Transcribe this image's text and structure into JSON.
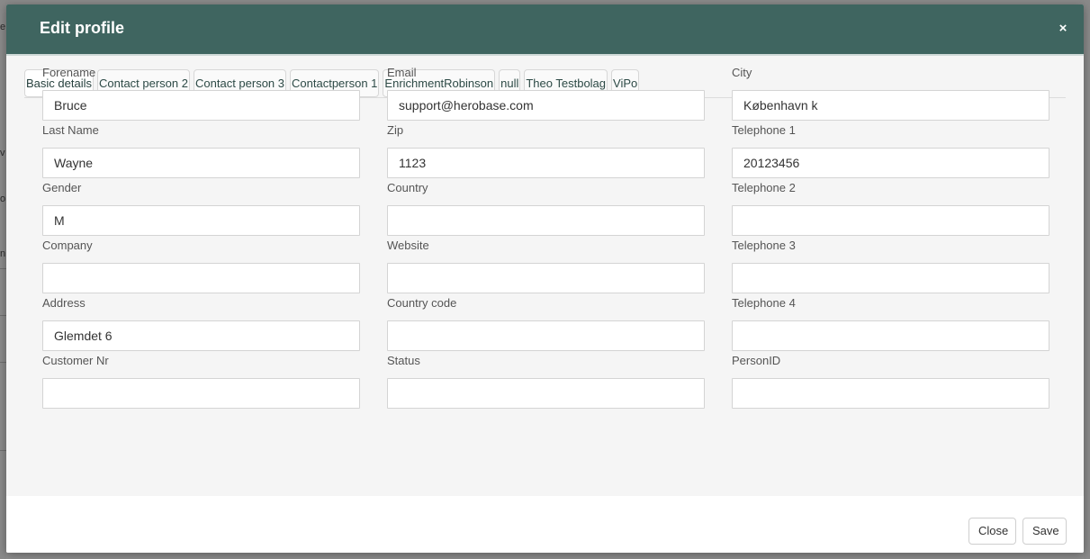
{
  "modal": {
    "title": "Edit profile",
    "close_glyph": "×"
  },
  "tabs": [
    {
      "label": "Basic details",
      "active": true
    },
    {
      "label": "Contact person 2",
      "active": false
    },
    {
      "label": "Contact person 3",
      "active": false
    },
    {
      "label": "Contactperson 1",
      "active": false
    },
    {
      "label": "EnrichmentRobinson",
      "active": false
    },
    {
      "label": "null",
      "active": false
    },
    {
      "label": "Theo Testbolag",
      "active": false
    },
    {
      "label": "ViPo",
      "active": false
    }
  ],
  "fields": {
    "forename": {
      "label": "Forename",
      "value": "Bruce"
    },
    "email": {
      "label": "Email",
      "value": "support@herobase.com"
    },
    "city": {
      "label": "City",
      "value": "København k"
    },
    "last_name": {
      "label": "Last Name",
      "value": "Wayne"
    },
    "zip": {
      "label": "Zip",
      "value": "1123"
    },
    "telephone1": {
      "label": "Telephone 1",
      "value": "20123456"
    },
    "gender": {
      "label": "Gender",
      "value": "M"
    },
    "country": {
      "label": "Country",
      "value": ""
    },
    "telephone2": {
      "label": "Telephone 2",
      "value": ""
    },
    "company": {
      "label": "Company",
      "value": ""
    },
    "website": {
      "label": "Website",
      "value": ""
    },
    "telephone3": {
      "label": "Telephone 3",
      "value": ""
    },
    "address": {
      "label": "Address",
      "value": "Glemdet 6"
    },
    "country_code": {
      "label": "Country code",
      "value": ""
    },
    "telephone4": {
      "label": "Telephone 4",
      "value": ""
    },
    "customer_nr": {
      "label": "Customer Nr",
      "value": ""
    },
    "status": {
      "label": "Status",
      "value": ""
    },
    "person_id": {
      "label": "PersonID",
      "value": ""
    }
  },
  "footer": {
    "close_label": "Close",
    "save_label": "Save"
  },
  "colors": {
    "header_bg": "#3f6560",
    "body_bg": "#f5f5f5"
  }
}
